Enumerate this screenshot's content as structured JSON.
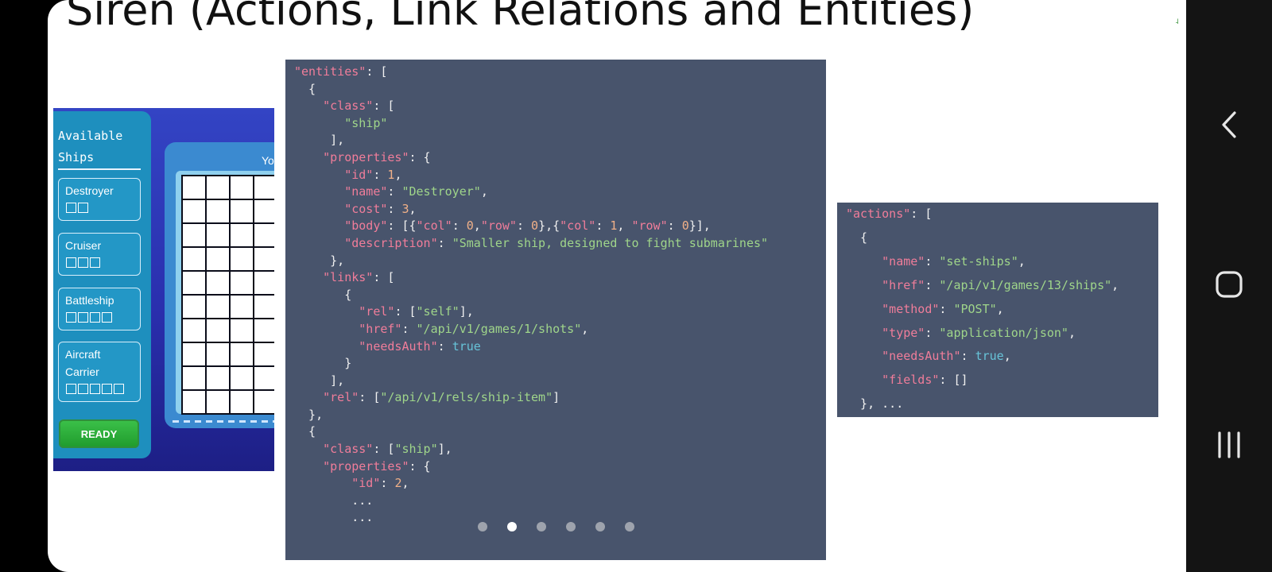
{
  "slide": {
    "title": "Siren (Actions, Link Relations and Entities)"
  },
  "game": {
    "panel_title_line1": "Available",
    "panel_title_line2": "Ships",
    "ships": [
      {
        "name_line1": "Destroyer",
        "name_line2": "",
        "size": 2
      },
      {
        "name_line1": "Cruiser",
        "name_line2": "",
        "size": 3
      },
      {
        "name_line1": "Battleship",
        "name_line2": "",
        "size": 4
      },
      {
        "name_line1": "Aircraft",
        "name_line2": "Carrier",
        "size": 5
      }
    ],
    "ready_label": "READY",
    "board_label": "Yo"
  },
  "entities_code": [
    "\"entities\": [",
    "  {",
    "    \"class\": [",
    "       \"ship\"",
    "     ],",
    "    \"properties\": {",
    "       \"id\": 1,",
    "       \"name\": \"Destroyer\",",
    "       \"cost\": 3,",
    "       \"body\": [{\"col\": 0,\"row\": 0},{\"col\": 1, \"row\": 0}],",
    "       \"description\": \"Smaller ship, designed to fight submarines\"",
    "     },",
    "    \"links\": [",
    "       {",
    "         \"rel\": [\"self\"],",
    "         \"href\": \"/api/v1/games/1/shots\",",
    "         \"needsAuth\": true",
    "       }",
    "     ],",
    "    \"rel\": [\"/api/v1/rels/ship-item\"]",
    "  },",
    "  {",
    "    \"class\": [\"ship\"],",
    "    \"properties\": {",
    "        \"id\": 2,",
    "        ...",
    "        ..."
  ],
  "actions_code": [
    "\"actions\": [",
    "  {",
    "     \"name\": \"set-ships\",",
    "     \"href\": \"/api/v1/games/13/ships\",",
    "     \"method\": \"POST\",",
    "     \"type\": \"application/json\",",
    "     \"needsAuth\": true,",
    "     \"fields\": []",
    "  }, ..."
  ],
  "carousel": {
    "count": 6,
    "active_index": 1
  },
  "navbar": {
    "icons": [
      "back-icon",
      "home-icon",
      "recents-icon"
    ]
  },
  "colors": {
    "code_bg": "#48546c",
    "key": "#f07d9a",
    "string": "#9fd58a",
    "number": "#f0b088",
    "boolean": "#67c3d8"
  }
}
